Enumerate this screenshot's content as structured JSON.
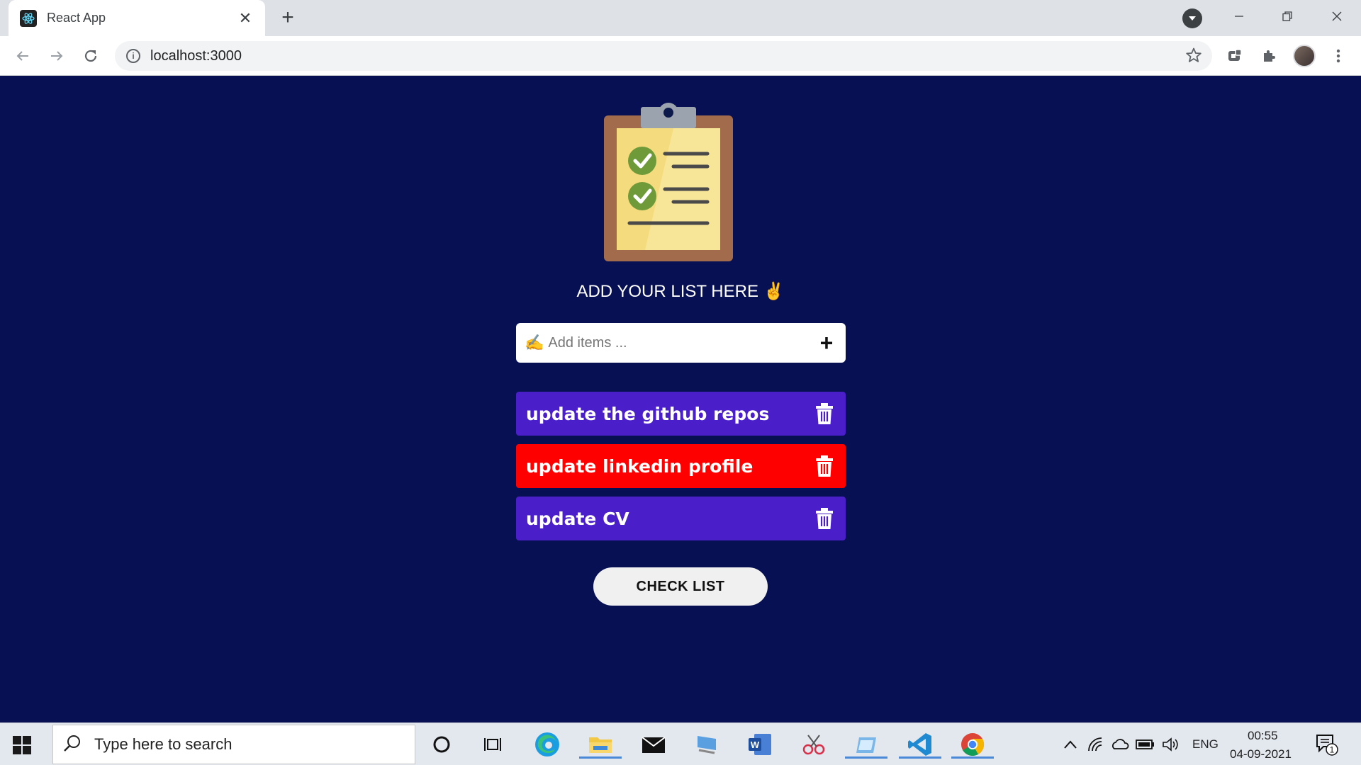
{
  "browser": {
    "tab_title": "React App",
    "url": "localhost:3000"
  },
  "app": {
    "heading": "ADD YOUR LIST HERE ✌",
    "input_emoji": "✍",
    "input_placeholder": "Add items ...",
    "add_symbol": "+",
    "items": [
      {
        "text": "update the github repos",
        "color": "#4a1ec8"
      },
      {
        "text": "update linkedin profile",
        "color": "#ff0000"
      },
      {
        "text": "update CV",
        "color": "#4a1ec8"
      }
    ],
    "check_button": "CHECK LIST",
    "background": "#061052"
  },
  "taskbar": {
    "search_placeholder": "Type here to search",
    "language": "ENG",
    "time": "00:55",
    "date": "04-09-2021",
    "notification_count": "1"
  }
}
